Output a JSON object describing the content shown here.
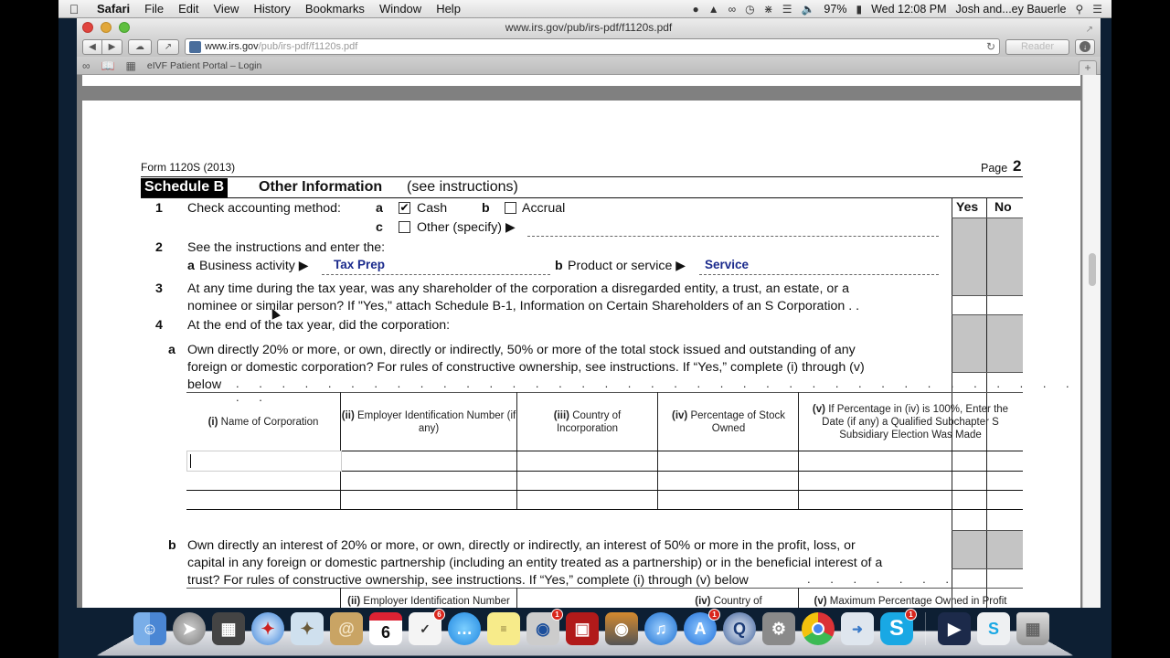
{
  "menubar": {
    "app": "Safari",
    "items": [
      "File",
      "Edit",
      "View",
      "History",
      "Bookmarks",
      "Window",
      "Help"
    ],
    "battery": "97%",
    "clock": "Wed 12:08 PM",
    "user": "Josh and...ey Bauerle"
  },
  "browser": {
    "window_title": "www.irs.gov/pub/irs-pdf/f1120s.pdf",
    "url_host": "www.irs.gov",
    "url_path": "/pub/irs-pdf/f1120s.pdf",
    "reader_label": "Reader",
    "bookmark": "eIVF Patient Portal – Login",
    "new_tab": "+"
  },
  "form": {
    "form_id": "Form 1120S (2013)",
    "page_label": "Page",
    "page_number": "2",
    "schedule": "Schedule B",
    "section_title": "Other Information",
    "section_note": "(see instructions)",
    "yes_label": "Yes",
    "no_label": "No",
    "q1": {
      "num": "1",
      "text": "Check accounting method:",
      "opt_a_letter": "a",
      "opt_a_label": "Cash",
      "opt_a_checked": true,
      "opt_b_letter": "b",
      "opt_b_label": "Accrual",
      "opt_b_checked": false,
      "opt_c_letter": "c",
      "opt_c_label": "Other (specify) ▶",
      "opt_c_checked": false
    },
    "q2": {
      "num": "2",
      "text": "See the instructions and enter the:",
      "a_letter": "a",
      "a_label": "Business activity ▶",
      "a_value": "Tax Prep",
      "b_letter": "b",
      "b_label": "Product or service ▶",
      "b_value": "Service"
    },
    "q3": {
      "num": "3",
      "line1": "At any time during the tax year, was any shareholder of the corporation a disregarded entity, a trust, an estate, or a",
      "line2": "nominee or similar person? If \"Yes,\" attach Schedule B-1, Information on Certain Shareholders of an S Corporation .   ."
    },
    "q4": {
      "num": "4",
      "text": "At the end of the tax year, did the corporation:",
      "a_letter": "a",
      "a_line1": "Own directly 20% or more, or own, directly or indirectly, 50% or more of the total stock issued and outstanding of any",
      "a_line2": "foreign or domestic corporation? For rules of constructive ownership, see instructions. If “Yes,” complete (i) through (v)",
      "a_line3": "below",
      "table_a_headers": [
        {
          "num": "(i)",
          "text": "Name of Corporation"
        },
        {
          "num": "(ii)",
          "text": "Employer Identification Number (if any)"
        },
        {
          "num": "(iii)",
          "text": "Country of Incorporation"
        },
        {
          "num": "(iv)",
          "text": "Percentage of Stock Owned"
        },
        {
          "num": "(v)",
          "text": "If Percentage in (iv) is 100%, Enter the Date (if any) a Qualified Subchapter S Subsidiary Election Was Made"
        }
      ],
      "b_letter": "b",
      "b_line1": "Own directly an interest of 20% or more, or own, directly or indirectly, an interest of 50% or more in the profit, loss, or",
      "b_line2": "capital in any foreign or domestic partnership (including an entity treated as a partnership) or in the beneficial interest of a",
      "b_line3": "trust? For rules of constructive ownership, see instructions. If “Yes,” complete (i) through (v) below",
      "table_b_headers_partial": [
        {
          "num": "(ii)",
          "text": "Employer Identification Number"
        },
        {
          "num": "(iv)",
          "text": "Country of"
        },
        {
          "num": "(v)",
          "text": "Maximum Percentage Owned in Profit"
        }
      ]
    }
  },
  "dock": {
    "items": [
      {
        "name": "Finder"
      },
      {
        "name": "Launchpad"
      },
      {
        "name": "Mission Control"
      },
      {
        "name": "Safari"
      },
      {
        "name": "Mail"
      },
      {
        "name": "Contacts"
      },
      {
        "name": "Calendar",
        "label": "6"
      },
      {
        "name": "Reminders",
        "badge": "6"
      },
      {
        "name": "Messages"
      },
      {
        "name": "Notes"
      },
      {
        "name": "FaceTime",
        "badge": "1"
      },
      {
        "name": "Photo Booth"
      },
      {
        "name": "iPhoto"
      },
      {
        "name": "iTunes"
      },
      {
        "name": "App Store",
        "badge": "1"
      },
      {
        "name": "QuickTime Player"
      },
      {
        "name": "System Preferences"
      },
      {
        "name": "Google Chrome"
      },
      {
        "name": "Preview"
      },
      {
        "name": "Skype",
        "badge": "1"
      },
      {
        "name": "Downloads Stack"
      },
      {
        "name": "Skype Window"
      },
      {
        "name": "Trash"
      }
    ]
  }
}
